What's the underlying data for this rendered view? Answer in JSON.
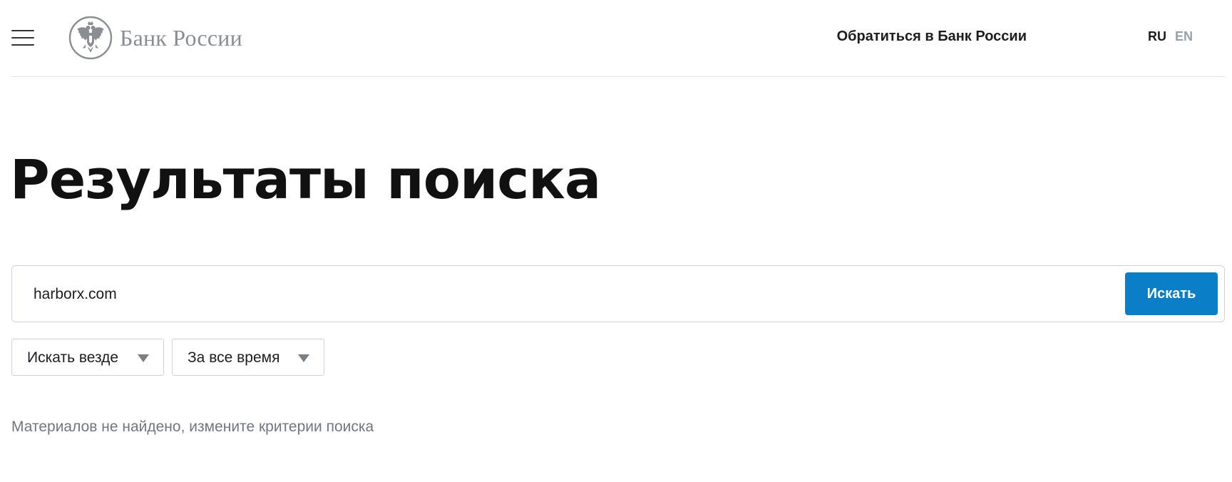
{
  "header": {
    "menu_icon": "hamburger-menu-icon",
    "logo_text": "Банк России",
    "logo_emblem": "double-headed-eagle-emblem",
    "contact_link": "Обратиться в Банк России",
    "languages": {
      "ru": "RU",
      "en": "EN",
      "active": "RU"
    }
  },
  "main": {
    "title": "Результаты поиска",
    "search": {
      "value": "harborx.com",
      "button_label": "Искать"
    },
    "filters": {
      "scope": {
        "value": "Искать везде",
        "icon": "caret-down-icon"
      },
      "period": {
        "value": "За все время",
        "icon": "caret-down-icon"
      }
    },
    "empty_message": "Материалов не найдено, измените критерии поиска"
  },
  "colors": {
    "accent_button": "#0a7ec6",
    "logo_gray": "#8a8e93",
    "muted_text": "#707780",
    "inactive_lang": "#9aa0a6",
    "border": "#cfd3d7"
  }
}
